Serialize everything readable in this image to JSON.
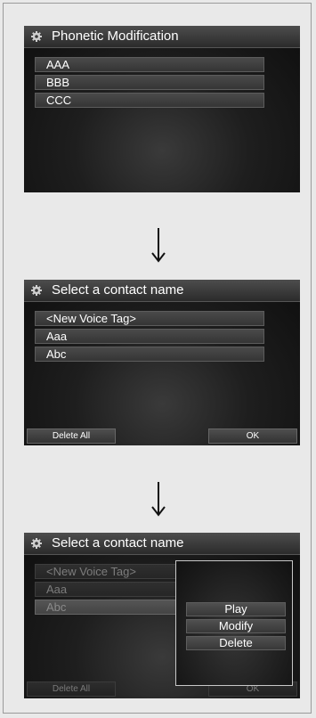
{
  "screen1": {
    "title": "Phonetic Modification",
    "items": [
      "AAA",
      "BBB",
      "CCC"
    ]
  },
  "screen2": {
    "title": "Select a contact name",
    "items": [
      "<New Voice Tag>",
      "Aaa",
      "Abc"
    ],
    "delete_all_label": "Delete All",
    "ok_label": "OK"
  },
  "screen3": {
    "title": "Select a contact name",
    "items": [
      "<New Voice Tag>",
      "Aaa",
      "Abc"
    ],
    "delete_all_label": "Delete All",
    "ok_label": "OK",
    "popup_items": [
      "Play",
      "Modify",
      "Delete"
    ]
  },
  "icons": {
    "title_icon": "gear-icon",
    "arrow": "arrow-down-icon"
  },
  "colors": {
    "screen_bg": "#111111",
    "title_bar": "#3a3a3a",
    "text": "#ffffff",
    "page_bg": "#e9e9e9"
  }
}
